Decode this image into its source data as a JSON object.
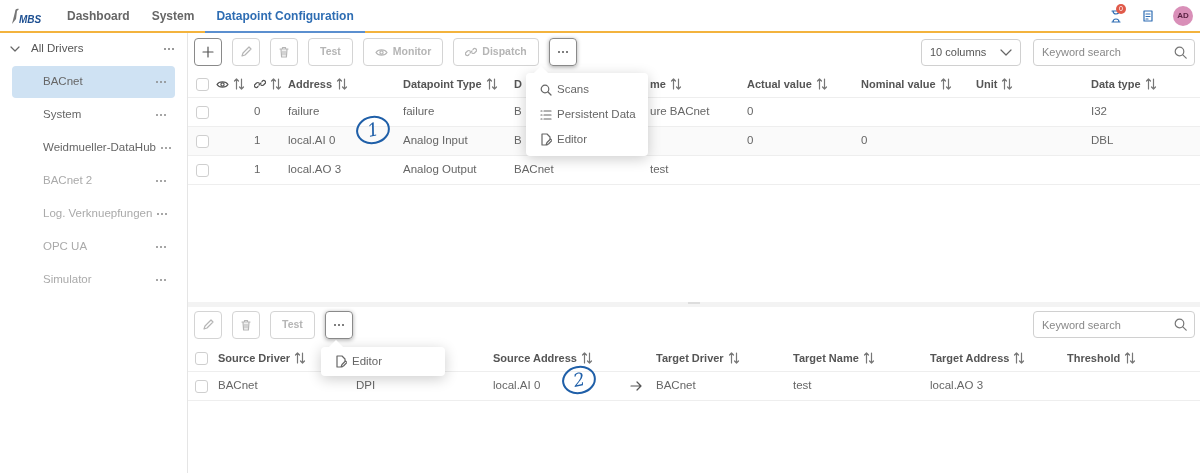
{
  "logo": "MBS",
  "nav_tabs": [
    {
      "label": "Dashboard",
      "selected": false
    },
    {
      "label": "System",
      "selected": false
    },
    {
      "label": "Datapoint Configuration",
      "selected": true
    }
  ],
  "header_actions": {
    "notification_count": "0",
    "avatar": "AD"
  },
  "sidebar": {
    "root": {
      "label": "All Drivers",
      "expanded": true
    },
    "items": [
      {
        "label": "BACnet",
        "selected": true,
        "disabled": false
      },
      {
        "label": "System",
        "selected": false,
        "disabled": false
      },
      {
        "label": "Weidmueller-DataHub",
        "selected": false,
        "disabled": false
      },
      {
        "label": "BACnet 2",
        "selected": false,
        "disabled": true
      },
      {
        "label": "Log. Verknuepfungen",
        "selected": false,
        "disabled": true
      },
      {
        "label": "OPC UA",
        "selected": false,
        "disabled": true
      },
      {
        "label": "Simulator",
        "selected": false,
        "disabled": true
      }
    ]
  },
  "datapoints": {
    "toolbar": [
      {
        "kind": "add",
        "disabled": false
      },
      {
        "kind": "edit",
        "disabled": true
      },
      {
        "kind": "delete",
        "disabled": true
      },
      {
        "kind": "text",
        "label": "Test",
        "disabled": true
      },
      {
        "kind": "monitor",
        "label": "Monitor",
        "disabled": true
      },
      {
        "kind": "dispatch",
        "label": "Dispatch",
        "disabled": true
      },
      {
        "kind": "more",
        "disabled": false,
        "expanded": true
      }
    ],
    "columns_select": "10 columns",
    "search": {
      "placeholder": "Keyword search"
    },
    "menu": [
      {
        "kind": "scans",
        "label": "Scans"
      },
      {
        "kind": "list",
        "label": "Persistent Data"
      },
      {
        "kind": "editor",
        "label": "Editor"
      }
    ],
    "all_checked": false,
    "columns": [
      {
        "kind": "icon",
        "sortable": true
      },
      {
        "kind": "icon",
        "sortable": true
      },
      {
        "label": "Address",
        "sortable": true
      },
      {
        "label": "Datapoint Type",
        "sortable": true
      },
      {
        "label": "D",
        "sortable": false
      },
      {
        "label": "me",
        "sortable": true
      },
      {
        "label": "Actual value",
        "sortable": true
      },
      {
        "label": "Nominal value",
        "sortable": true
      },
      {
        "label": "Unit",
        "sortable": true
      },
      {
        "label": "Data type",
        "sortable": true
      }
    ],
    "rows": [
      {
        "checked": false,
        "cells": [
          null,
          "0",
          "failure",
          "failure",
          "B",
          "ure BACnet",
          "0",
          null,
          null,
          "I32"
        ]
      },
      {
        "checked": false,
        "cells": [
          null,
          "1",
          "local.AI 0",
          "Analog Input",
          "B",
          null,
          "0",
          "0",
          null,
          "DBL"
        ]
      },
      {
        "checked": false,
        "cells": [
          null,
          "1",
          "local.AO 3",
          "Analog Output",
          "BACnet",
          "test",
          null,
          null,
          null,
          null
        ]
      }
    ]
  },
  "dispatches": {
    "toolbar": [
      {
        "kind": "edit",
        "disabled": true
      },
      {
        "kind": "delete",
        "disabled": true
      },
      {
        "kind": "text",
        "label": "Test",
        "disabled": true
      },
      {
        "kind": "more",
        "disabled": false,
        "expanded": true
      }
    ],
    "search": {
      "placeholder": "Keyword search"
    },
    "menu": [
      {
        "kind": "editor",
        "label": "Editor"
      }
    ],
    "all_checked": false,
    "columns": [
      {
        "label": "Source Driver",
        "sortable": true
      },
      {},
      {
        "label": "Source Address",
        "sortable": true
      },
      {
        "kind": "arrow"
      },
      {
        "label": "Target Driver",
        "sortable": true
      },
      {
        "label": "Target Name",
        "sortable": true
      },
      {
        "label": "Target Address",
        "sortable": true
      },
      {
        "label": "Threshold",
        "sortable": true
      }
    ],
    "rows": [
      {
        "checked": false,
        "cells": [
          "BACnet",
          "DPI",
          "local.AI 0",
          null,
          "BACnet",
          "test",
          "local.AO 3",
          null
        ]
      }
    ]
  },
  "annotations": [
    {
      "label": "1"
    },
    {
      "label": "2"
    }
  ]
}
